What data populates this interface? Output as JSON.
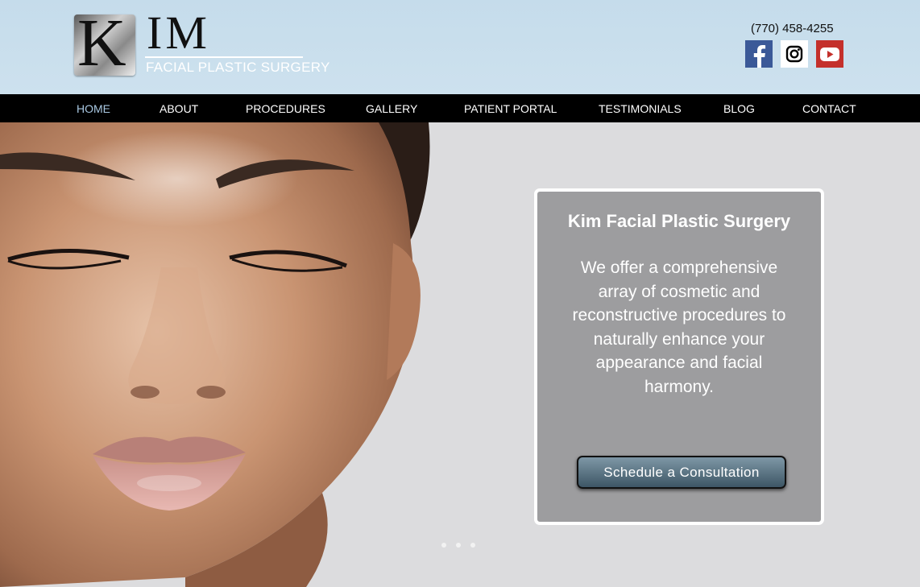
{
  "brand": {
    "logo_letter": "K",
    "logo_name": "IM",
    "tagline": "FACIAL PLASTIC SURGERY"
  },
  "contact": {
    "phone": "(770) 458-4255"
  },
  "social": [
    {
      "icon": "facebook-icon",
      "color": "#3b5998"
    },
    {
      "icon": "instagram-icon",
      "color": "#ffffff"
    },
    {
      "icon": "youtube-icon",
      "color": "#c4302b"
    }
  ],
  "nav": {
    "items": [
      {
        "label": "HOME",
        "active": true
      },
      {
        "label": "ABOUT"
      },
      {
        "label": "PROCEDURES"
      },
      {
        "label": "GALLERY"
      },
      {
        "label": "PATIENT PORTAL"
      },
      {
        "label": "TESTIMONIALS"
      },
      {
        "label": "BLOG"
      },
      {
        "label": "CONTACT"
      }
    ]
  },
  "hero": {
    "title": "Kim Facial Plastic Surgery",
    "text": "We offer a comprehensive array of cosmetic and reconstructive procedures to naturally enhance your appearance and facial harmony.",
    "cta_label": "Schedule a Consultation",
    "slides_total": 3,
    "active_slide": 1
  },
  "colors": {
    "nav_bg": "#000000",
    "nav_active": "#a9c8e2",
    "header_bg": "#c5dceb",
    "card_bg": "#9d9d9f"
  }
}
